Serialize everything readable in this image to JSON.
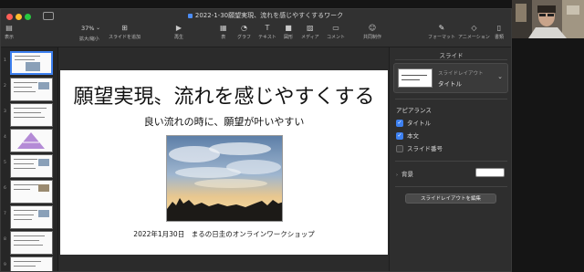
{
  "window": {
    "title": "2022-1-30願望実現、流れを感じやすくするワーク"
  },
  "toolbar": {
    "view_label": "表示",
    "zoom_value": "37%",
    "zoom_label": "拡大/縮小",
    "add_slide_label": "スライドを追加",
    "play_label": "再生",
    "table_label": "表",
    "chart_label": "グラフ",
    "text_label": "テキスト",
    "shape_label": "図形",
    "media_label": "メディア",
    "comment_label": "コメント",
    "collaborate_label": "共同制作",
    "format_label": "フォーマット",
    "animate_label": "アニメーション",
    "document_label": "書類"
  },
  "navigator": {
    "selected_index": 1,
    "numbers": [
      "1",
      "2",
      "3",
      "4",
      "5",
      "6",
      "7",
      "8",
      "9"
    ]
  },
  "slide": {
    "title": "願望実現〟流れを感じやすくする",
    "subtitle": "良い流れの時に、願望が叶いやすい",
    "date_line": "2022年1月30日　まるの日圭のオンラインワークショップ"
  },
  "inspector": {
    "tab": "スライド",
    "layout_caption": "スライドレイアウト",
    "layout_name": "タイトル",
    "appearance_header": "アピアランス",
    "checkboxes": [
      {
        "label": "タイトル",
        "checked": true
      },
      {
        "label": "本文",
        "checked": true
      },
      {
        "label": "スライド番号",
        "checked": false
      }
    ],
    "background_label": "背景",
    "background_color": "#ffffff",
    "edit_layout_button": "スライドレイアウトを編集"
  },
  "colors": {
    "accent": "#3d80f0",
    "close": "#ff5f57",
    "minimize": "#febc2e",
    "maximize": "#28c840"
  }
}
